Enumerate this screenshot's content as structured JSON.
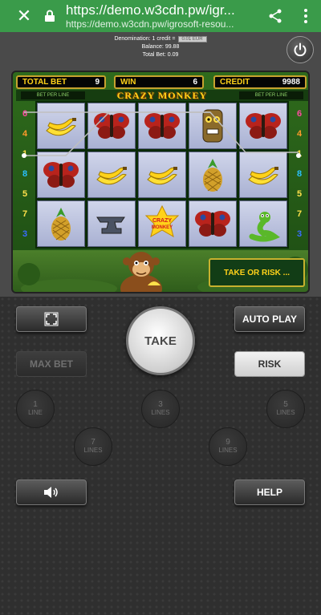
{
  "browser": {
    "url_title": "https://demo.w3cdn.pw/igr...",
    "url_sub": "https://demo.w3cdn.pw/igrosoft-resou..."
  },
  "info": {
    "denomination_label": "Denomination: 1 credit =",
    "denomination_value": "0.01 EUR",
    "balance": "Balance: 99.88",
    "total_bet": "Total Bet: 0.09"
  },
  "panels": {
    "total_bet_label": "TOTAL BET",
    "total_bet_value": "9",
    "win_label": "WIN",
    "win_value": "6",
    "credit_label": "CREDIT",
    "credit_value": "9988"
  },
  "title": "CRAZY MONKEY",
  "bet_per_line_left": "BET PER LINE",
  "bet_per_line_right": "BET PER LINE",
  "line_numbers_left": [
    "6",
    "4",
    "1",
    "8",
    "5",
    "7",
    "3"
  ],
  "line_numbers_right": [
    "6",
    "4",
    "1",
    "8",
    "5",
    "7",
    "3"
  ],
  "reels": [
    [
      "banana",
      "butterfly",
      "pineapple"
    ],
    [
      "butterfly",
      "banana",
      "anvil"
    ],
    [
      "butterfly",
      "banana",
      "crazy-monkey"
    ],
    [
      "totem",
      "pineapple",
      "butterfly"
    ],
    [
      "butterfly",
      "banana",
      "snake"
    ]
  ],
  "take_or_risk": "TAKE OR RISK ...",
  "controls": {
    "auto_play": "AUTO PLAY",
    "take": "TAKE",
    "max_bet": "MAX BET",
    "risk": "RISK",
    "help": "HELP",
    "lines": [
      {
        "n": "1",
        "label": "LINE"
      },
      {
        "n": "3",
        "label": "LINES"
      },
      {
        "n": "5",
        "label": "LINES"
      },
      {
        "n": "7",
        "label": "LINES"
      },
      {
        "n": "9",
        "label": "LINES"
      }
    ]
  },
  "colors": {
    "browser_green": "#3a9b4a",
    "panel_gold": "#ffd21a"
  }
}
